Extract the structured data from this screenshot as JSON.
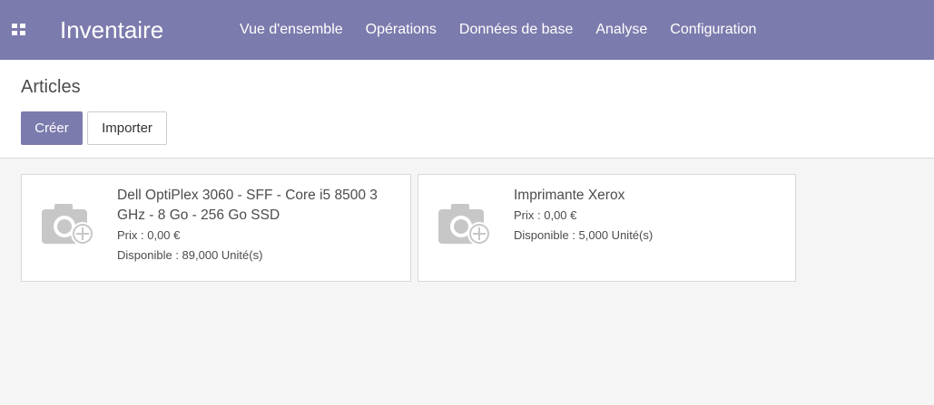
{
  "navbar": {
    "app_title": "Inventaire",
    "menu": [
      {
        "label": "Vue d'ensemble"
      },
      {
        "label": "Opérations"
      },
      {
        "label": "Données de base"
      },
      {
        "label": "Analyse"
      },
      {
        "label": "Configuration"
      }
    ],
    "color": "#7c7bad",
    "apps_icon": "grid-icon"
  },
  "control_panel": {
    "breadcrumb": "Articles",
    "create_label": "Créer",
    "import_label": "Importer"
  },
  "products": [
    {
      "name": "Dell OptiPlex 3060 - SFF - Core i5 8500 3 GHz - 8 Go - 256 Go SSD",
      "price": "Prix : 0,00 €",
      "stock": "Disponible : 89,000 Unité(s)",
      "image_icon": "camera-plus-icon"
    },
    {
      "name": "Imprimante Xerox",
      "price": "Prix : 0,00 €",
      "stock": "Disponible : 5,000 Unité(s)",
      "image_icon": "camera-plus-icon"
    }
  ]
}
